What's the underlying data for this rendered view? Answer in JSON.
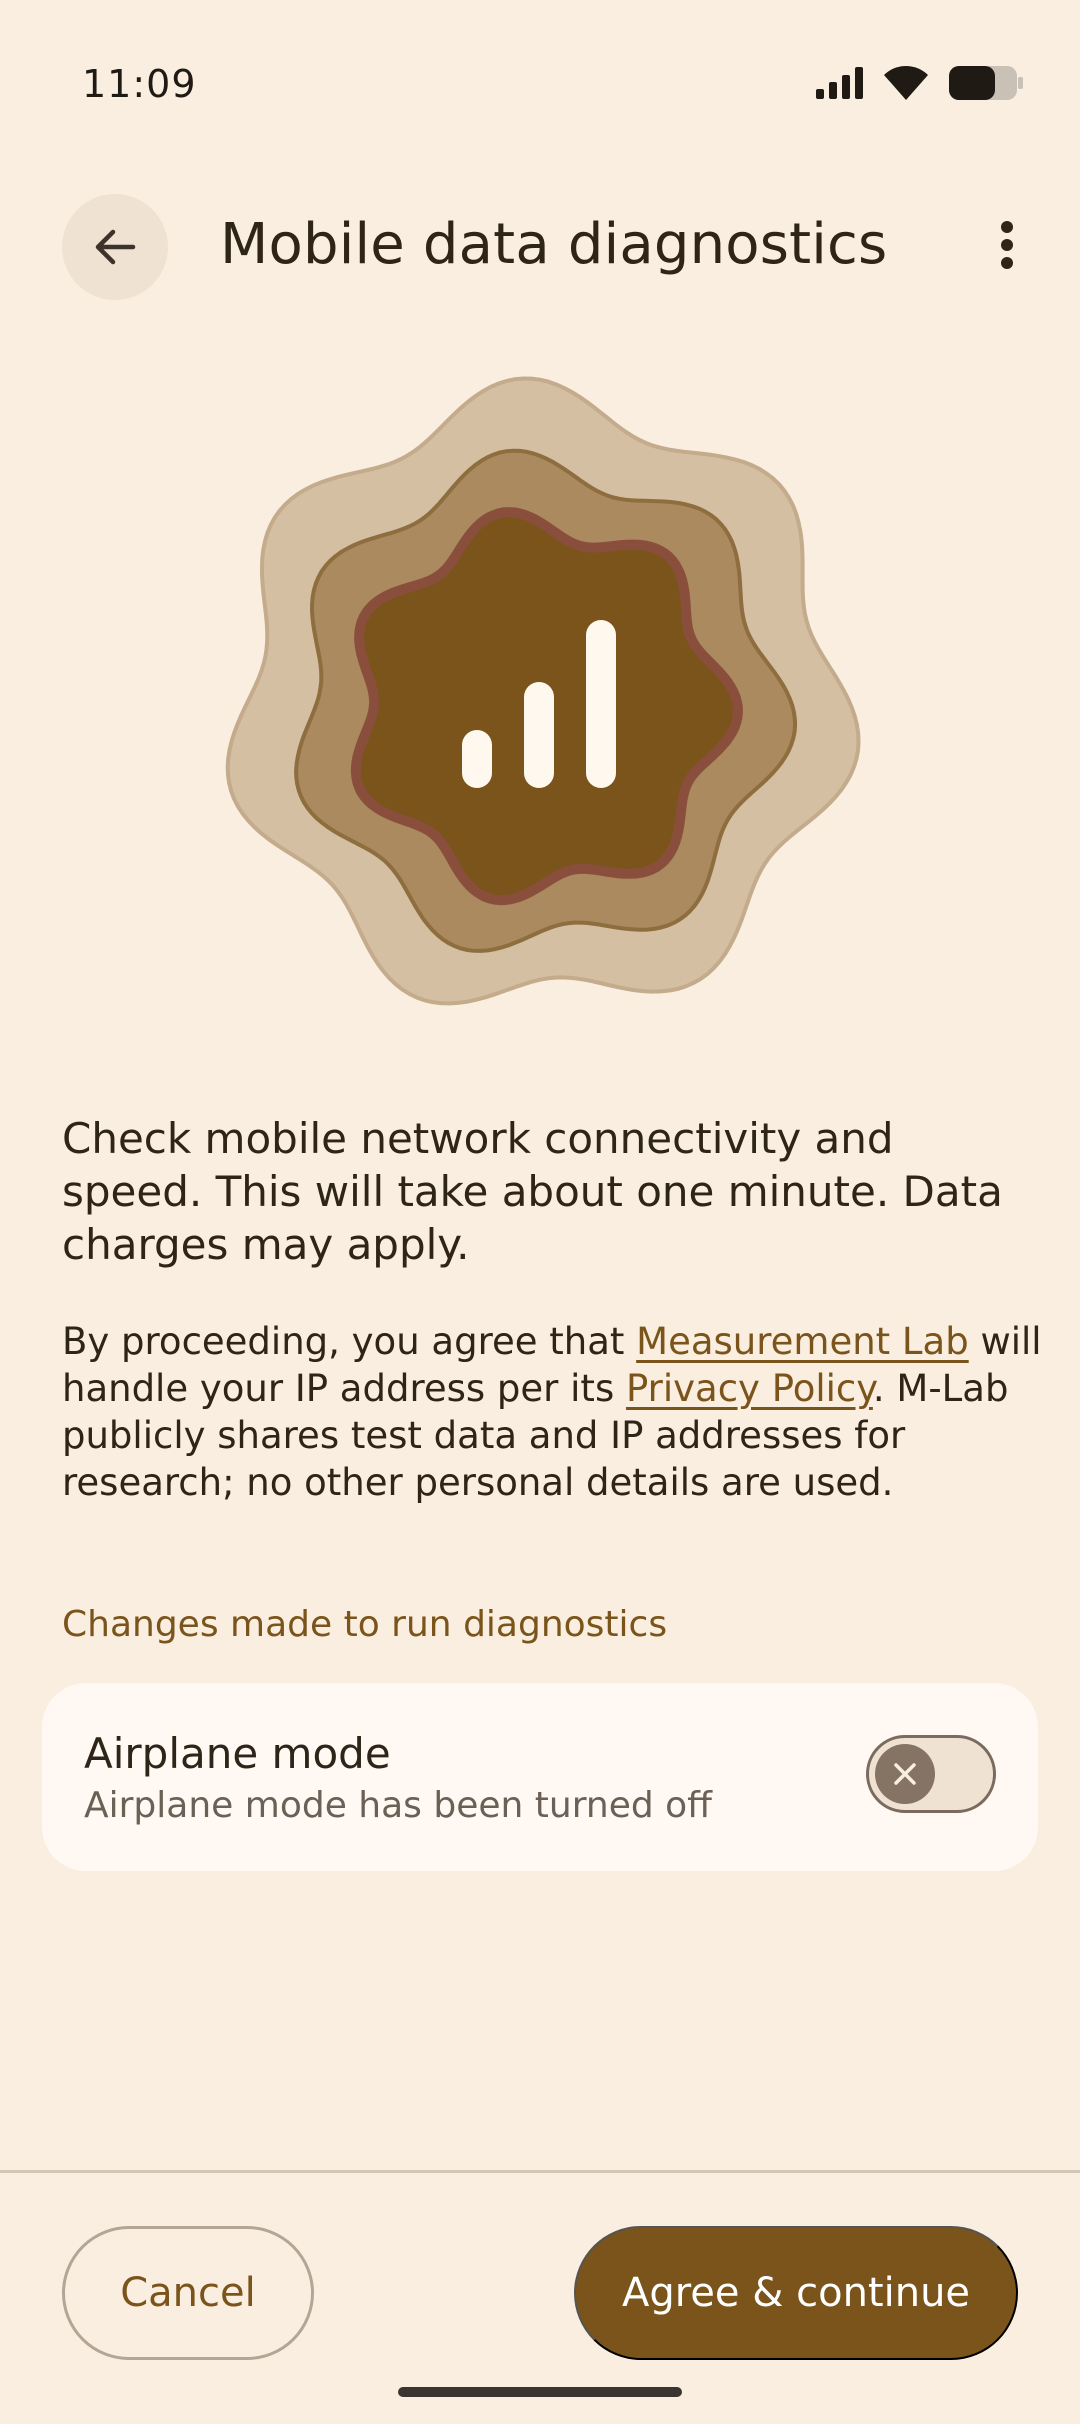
{
  "status_bar": {
    "time": "11:09",
    "icons": [
      "signal-icon",
      "wifi-icon",
      "battery-icon"
    ],
    "battery_level": 0.7
  },
  "header": {
    "back_icon": "arrow-back-icon",
    "title": "Mobile data diagnostics",
    "more_icon": "more-vert-icon"
  },
  "hero": {
    "icon": "signal-bars-icon"
  },
  "description": "Check mobile network connectivity and speed. This will take about one minute. Data charges may apply.",
  "consent": {
    "part1": "By proceeding, you agree that ",
    "link1": "Measurement Lab",
    "part2": " will handle your IP address per its ",
    "link2": "Privacy Policy",
    "part3": ". M-Lab publicly shares test data and IP addresses for research; no other personal details are used."
  },
  "changes_section": {
    "label": "Changes made to run diagnostics",
    "items": [
      {
        "title": "Airplane mode",
        "subtitle": "Airplane mode has been turned off",
        "toggle_on": false
      }
    ]
  },
  "actions": {
    "cancel": "Cancel",
    "agree": "Agree & continue"
  },
  "colors": {
    "background": "#FAEEE0",
    "accent": "#7A541A",
    "card": "#FFF8F3"
  }
}
